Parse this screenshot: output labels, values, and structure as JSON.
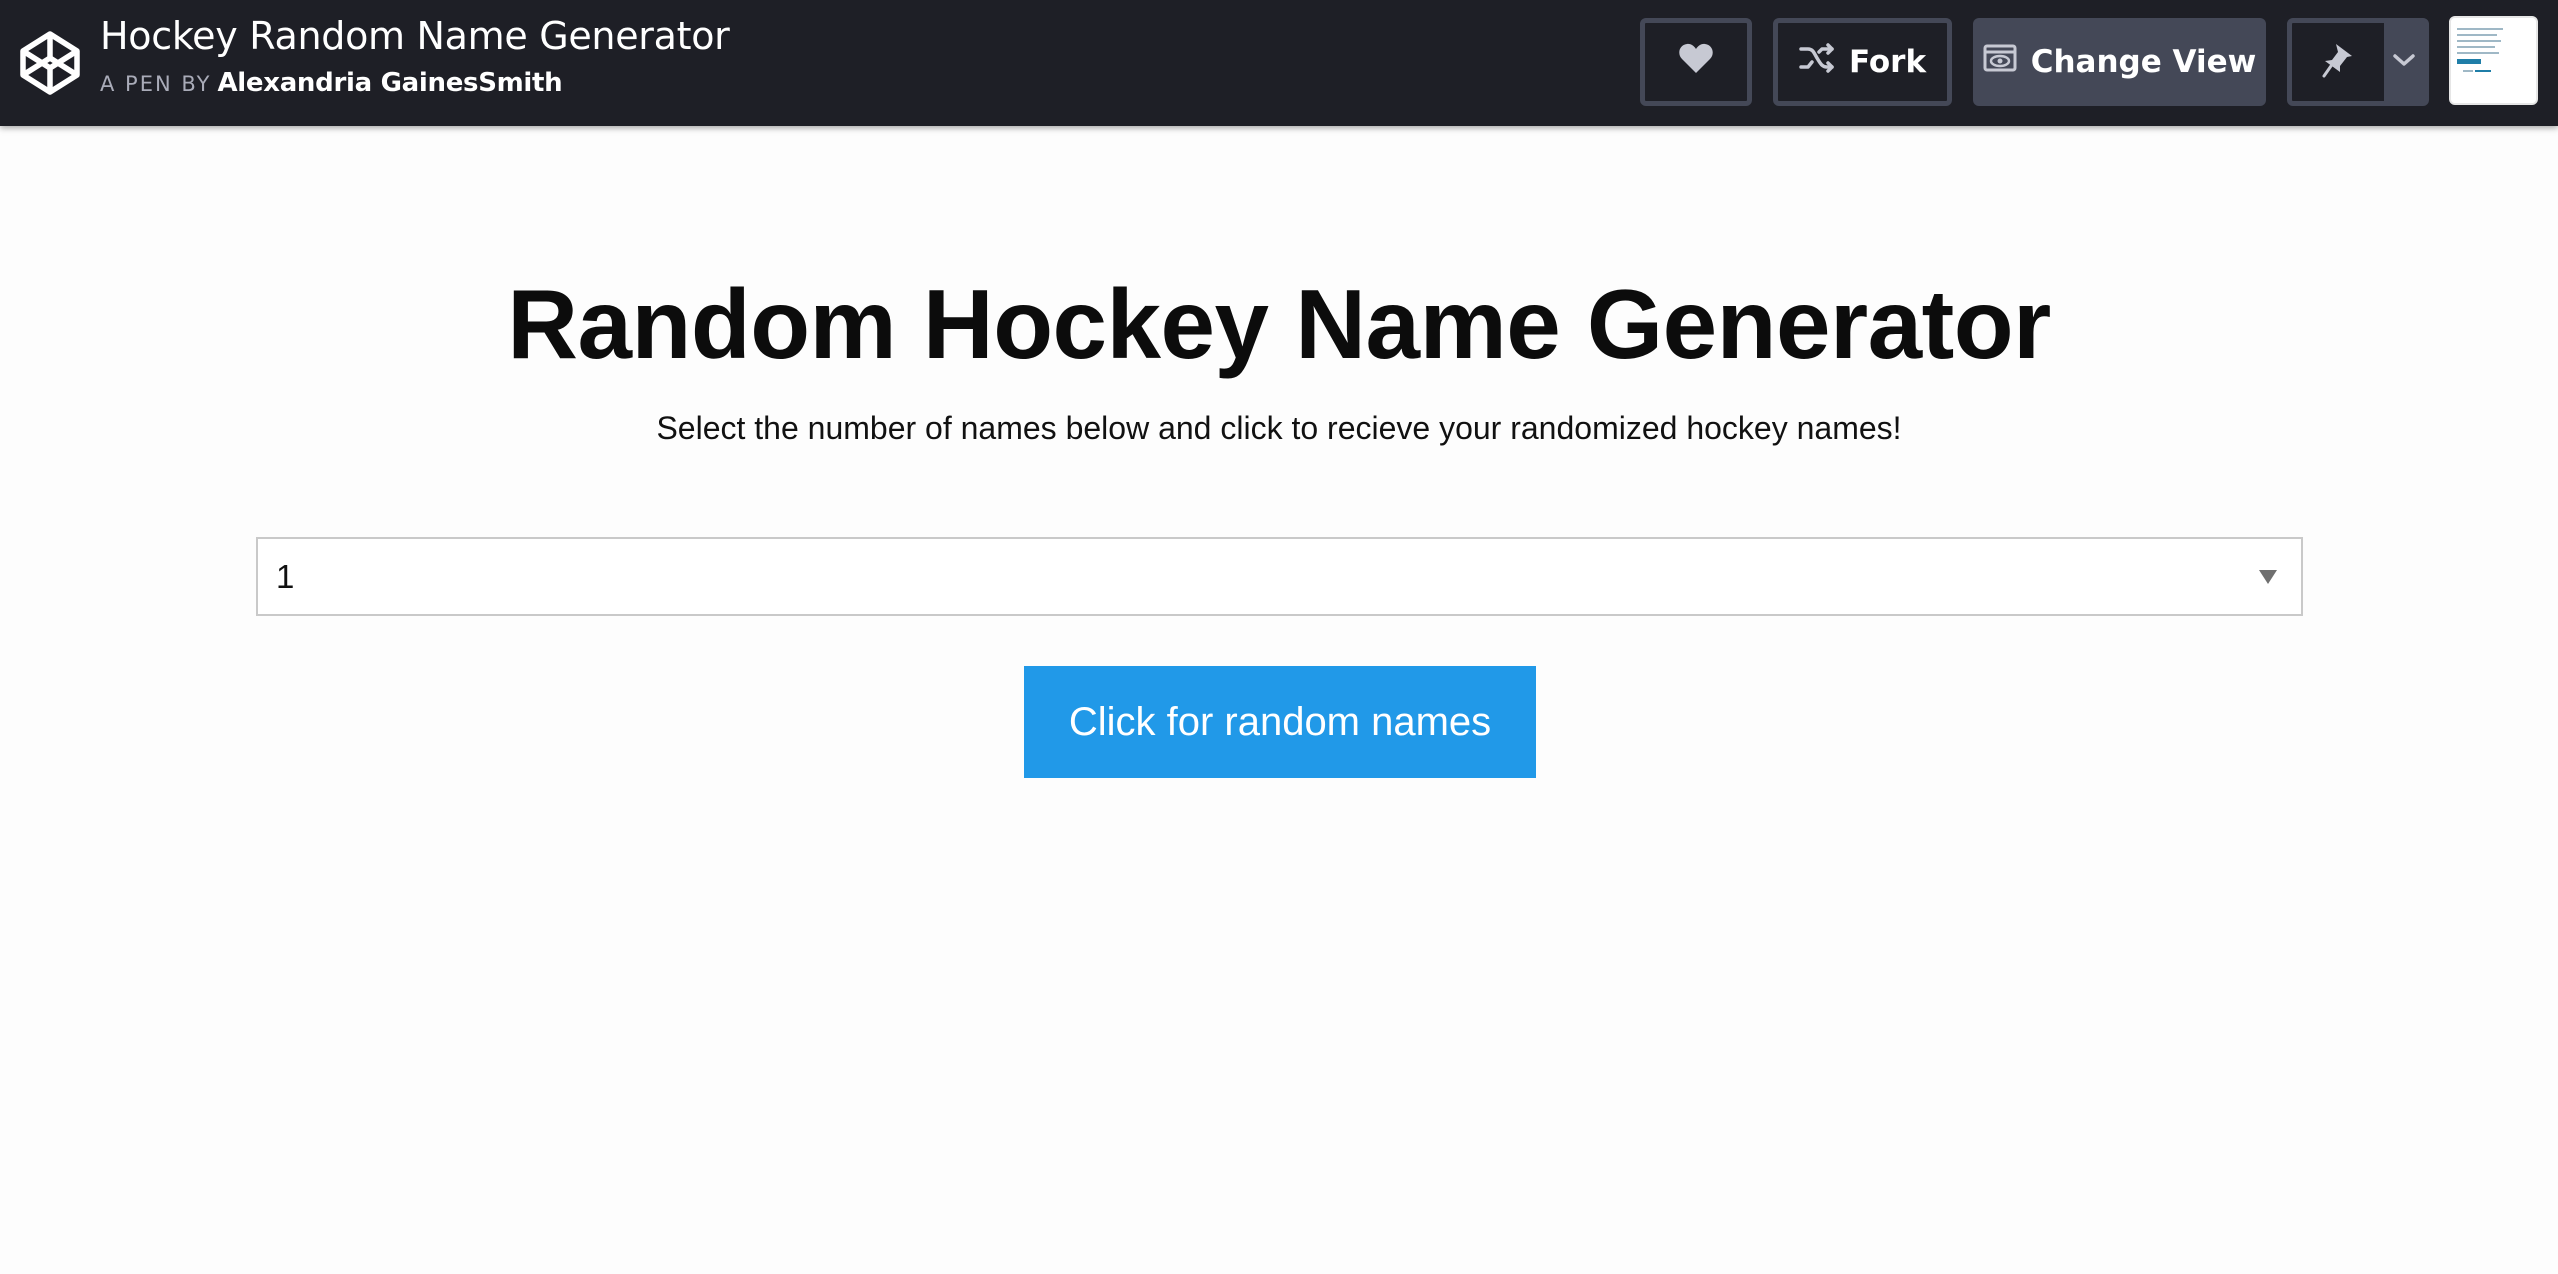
{
  "header": {
    "pen_title": "Hockey Random Name Generator",
    "by_label": "A PEN BY",
    "author": "Alexandria GainesSmith",
    "buttons": {
      "heart_icon": "heart-icon",
      "fork_label": "Fork",
      "fork_icon": "fork-icon",
      "change_view_label": "Change View",
      "change_view_icon": "eye-icon",
      "pin_icon": "pin-icon",
      "dropdown_icon": "chevron-down-icon"
    },
    "colors": {
      "bar": "#1e1f26",
      "button": "#444857",
      "text": "#ffffff"
    }
  },
  "main": {
    "title": "Random Hockey Name Generator",
    "subtitle": "Select the number of names below and click to recieve your randomized hockey names!",
    "select": {
      "selected_value": "1"
    },
    "button_label": "Click for random names",
    "colors": {
      "button": "#2199e8"
    }
  }
}
